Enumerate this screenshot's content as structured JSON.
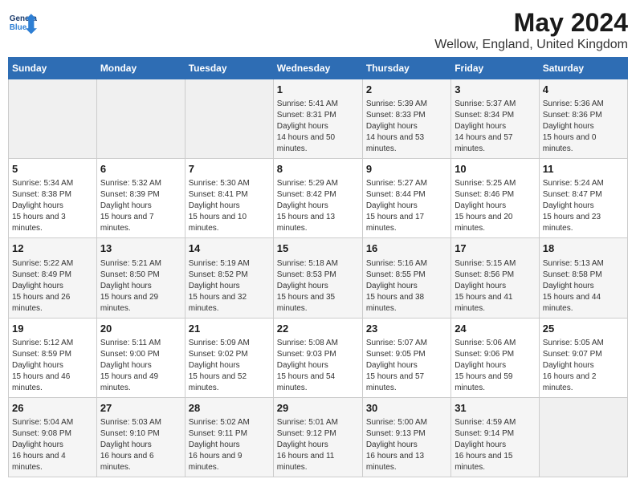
{
  "header": {
    "logo_text_general": "General",
    "logo_text_blue": "Blue",
    "month_year": "May 2024",
    "location": "Wellow, England, United Kingdom"
  },
  "days_of_week": [
    "Sunday",
    "Monday",
    "Tuesday",
    "Wednesday",
    "Thursday",
    "Friday",
    "Saturday"
  ],
  "weeks": [
    {
      "days": [
        {
          "num": "",
          "empty": true
        },
        {
          "num": "",
          "empty": true
        },
        {
          "num": "",
          "empty": true
        },
        {
          "num": "1",
          "sunrise": "5:41 AM",
          "sunset": "8:31 PM",
          "daylight": "14 hours and 50 minutes."
        },
        {
          "num": "2",
          "sunrise": "5:39 AM",
          "sunset": "8:33 PM",
          "daylight": "14 hours and 53 minutes."
        },
        {
          "num": "3",
          "sunrise": "5:37 AM",
          "sunset": "8:34 PM",
          "daylight": "14 hours and 57 minutes."
        },
        {
          "num": "4",
          "sunrise": "5:36 AM",
          "sunset": "8:36 PM",
          "daylight": "15 hours and 0 minutes."
        }
      ]
    },
    {
      "days": [
        {
          "num": "5",
          "sunrise": "5:34 AM",
          "sunset": "8:38 PM",
          "daylight": "15 hours and 3 minutes."
        },
        {
          "num": "6",
          "sunrise": "5:32 AM",
          "sunset": "8:39 PM",
          "daylight": "15 hours and 7 minutes."
        },
        {
          "num": "7",
          "sunrise": "5:30 AM",
          "sunset": "8:41 PM",
          "daylight": "15 hours and 10 minutes."
        },
        {
          "num": "8",
          "sunrise": "5:29 AM",
          "sunset": "8:42 PM",
          "daylight": "15 hours and 13 minutes."
        },
        {
          "num": "9",
          "sunrise": "5:27 AM",
          "sunset": "8:44 PM",
          "daylight": "15 hours and 17 minutes."
        },
        {
          "num": "10",
          "sunrise": "5:25 AM",
          "sunset": "8:46 PM",
          "daylight": "15 hours and 20 minutes."
        },
        {
          "num": "11",
          "sunrise": "5:24 AM",
          "sunset": "8:47 PM",
          "daylight": "15 hours and 23 minutes."
        }
      ]
    },
    {
      "days": [
        {
          "num": "12",
          "sunrise": "5:22 AM",
          "sunset": "8:49 PM",
          "daylight": "15 hours and 26 minutes."
        },
        {
          "num": "13",
          "sunrise": "5:21 AM",
          "sunset": "8:50 PM",
          "daylight": "15 hours and 29 minutes."
        },
        {
          "num": "14",
          "sunrise": "5:19 AM",
          "sunset": "8:52 PM",
          "daylight": "15 hours and 32 minutes."
        },
        {
          "num": "15",
          "sunrise": "5:18 AM",
          "sunset": "8:53 PM",
          "daylight": "15 hours and 35 minutes."
        },
        {
          "num": "16",
          "sunrise": "5:16 AM",
          "sunset": "8:55 PM",
          "daylight": "15 hours and 38 minutes."
        },
        {
          "num": "17",
          "sunrise": "5:15 AM",
          "sunset": "8:56 PM",
          "daylight": "15 hours and 41 minutes."
        },
        {
          "num": "18",
          "sunrise": "5:13 AM",
          "sunset": "8:58 PM",
          "daylight": "15 hours and 44 minutes."
        }
      ]
    },
    {
      "days": [
        {
          "num": "19",
          "sunrise": "5:12 AM",
          "sunset": "8:59 PM",
          "daylight": "15 hours and 46 minutes."
        },
        {
          "num": "20",
          "sunrise": "5:11 AM",
          "sunset": "9:00 PM",
          "daylight": "15 hours and 49 minutes."
        },
        {
          "num": "21",
          "sunrise": "5:09 AM",
          "sunset": "9:02 PM",
          "daylight": "15 hours and 52 minutes."
        },
        {
          "num": "22",
          "sunrise": "5:08 AM",
          "sunset": "9:03 PM",
          "daylight": "15 hours and 54 minutes."
        },
        {
          "num": "23",
          "sunrise": "5:07 AM",
          "sunset": "9:05 PM",
          "daylight": "15 hours and 57 minutes."
        },
        {
          "num": "24",
          "sunrise": "5:06 AM",
          "sunset": "9:06 PM",
          "daylight": "15 hours and 59 minutes."
        },
        {
          "num": "25",
          "sunrise": "5:05 AM",
          "sunset": "9:07 PM",
          "daylight": "16 hours and 2 minutes."
        }
      ]
    },
    {
      "days": [
        {
          "num": "26",
          "sunrise": "5:04 AM",
          "sunset": "9:08 PM",
          "daylight": "16 hours and 4 minutes."
        },
        {
          "num": "27",
          "sunrise": "5:03 AM",
          "sunset": "9:10 PM",
          "daylight": "16 hours and 6 minutes."
        },
        {
          "num": "28",
          "sunrise": "5:02 AM",
          "sunset": "9:11 PM",
          "daylight": "16 hours and 9 minutes."
        },
        {
          "num": "29",
          "sunrise": "5:01 AM",
          "sunset": "9:12 PM",
          "daylight": "16 hours and 11 minutes."
        },
        {
          "num": "30",
          "sunrise": "5:00 AM",
          "sunset": "9:13 PM",
          "daylight": "16 hours and 13 minutes."
        },
        {
          "num": "31",
          "sunrise": "4:59 AM",
          "sunset": "9:14 PM",
          "daylight": "16 hours and 15 minutes."
        },
        {
          "num": "",
          "empty": true
        }
      ]
    }
  ]
}
